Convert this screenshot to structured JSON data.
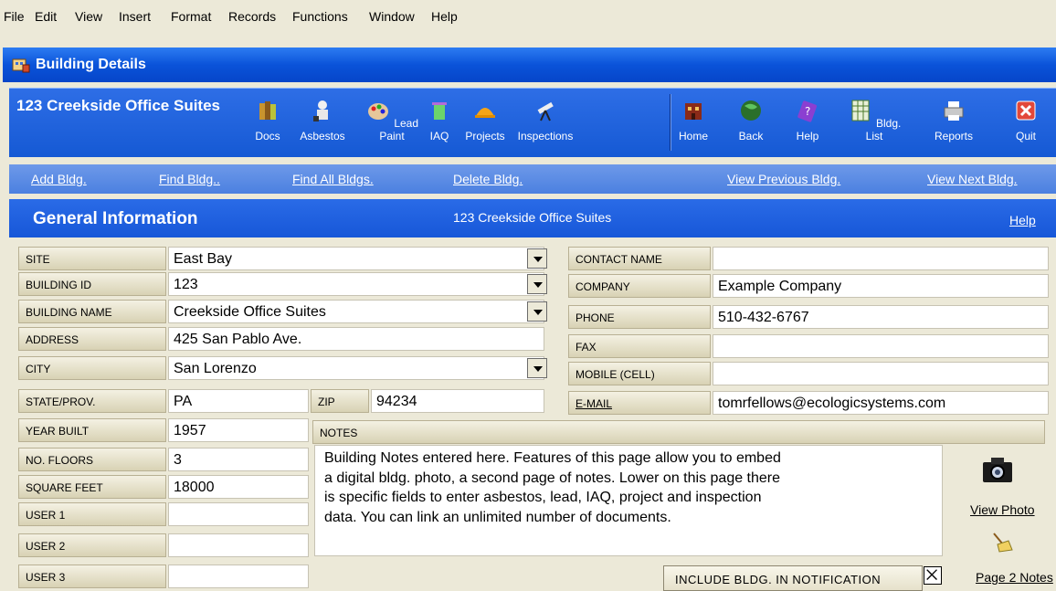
{
  "menu": [
    "File",
    "Edit",
    "View",
    "Insert",
    "Format",
    "Records",
    "Functions",
    "Window",
    "Help"
  ],
  "window": {
    "title": "Building Details"
  },
  "building": {
    "title": "123 Creekside Office Suites"
  },
  "toolbar": {
    "buttons": [
      "Docs",
      "Asbestos",
      "Lead Paint",
      "IAQ",
      "Projects",
      "Inspections",
      "Home",
      "Back",
      "Help",
      "Bldg. List",
      "Reports",
      "Quit"
    ]
  },
  "links": [
    "Add Bldg.",
    "Find Bldg..",
    "Find All Bldgs.",
    "Delete Bldg.",
    "View Previous Bldg.",
    "View Next Bldg."
  ],
  "section": {
    "title": "General Information",
    "subtitle": "123 Creekside Office Suites",
    "help": "Help"
  },
  "fields": {
    "site": {
      "label": "SITE",
      "value": "East Bay"
    },
    "building_id": {
      "label": "BUILDING ID",
      "value": "123"
    },
    "building_name": {
      "label": "BUILDING NAME",
      "value": "Creekside Office Suites"
    },
    "address": {
      "label": "ADDRESS",
      "value": "425 San Pablo Ave."
    },
    "city": {
      "label": "CITY",
      "value": "San Lorenzo"
    },
    "state": {
      "label": "STATE/PROV.",
      "value": "PA"
    },
    "zip": {
      "label": "ZIP",
      "value": "94234"
    },
    "year_built": {
      "label": "YEAR BUILT",
      "value": "1957"
    },
    "floors": {
      "label": "NO. FLOORS",
      "value": "3"
    },
    "square_feet": {
      "label": "SQUARE FEET",
      "value": "18000"
    },
    "user1": {
      "label": "USER 1",
      "value": ""
    },
    "user2": {
      "label": "USER 2",
      "value": ""
    },
    "user3": {
      "label": "USER 3",
      "value": ""
    },
    "contact_name": {
      "label": "CONTACT NAME",
      "value": ""
    },
    "company": {
      "label": "COMPANY",
      "value": "Example Company"
    },
    "phone": {
      "label": "PHONE",
      "value": "510-432-6767"
    },
    "fax": {
      "label": "FAX",
      "value": ""
    },
    "mobile": {
      "label": "MOBILE (CELL)",
      "value": ""
    },
    "email": {
      "label": "E-MAIL",
      "value": "tomrfellows@ecologicsystems.com"
    }
  },
  "notes": {
    "label": "NOTES",
    "lines": [
      "Building Notes entered here.  Features of this page allow you to  embed",
      "a digital bldg. photo, a second page of notes. Lower on this page there",
      "is specific fields to enter asbestos, lead, IAQ, project and inspection",
      "data.  You can link an unlimited number of documents."
    ]
  },
  "notification": {
    "label": "INCLUDE BLDG. IN NOTIFICATION",
    "checked": "true"
  },
  "side": {
    "view_photo": "View Photo",
    "page2": "Page 2 Notes"
  }
}
